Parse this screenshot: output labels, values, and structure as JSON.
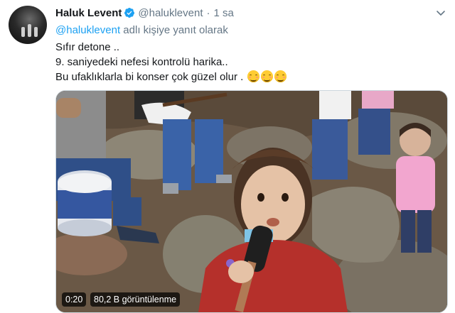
{
  "tweet": {
    "display_name": "Haluk Levent",
    "handle": "@haluklevent",
    "separator": "·",
    "time": "1 sa",
    "reply_mention": "@haluklevent",
    "reply_text": "adlı kişiye yanıt olarak",
    "lines": [
      "Sıfır detone ..",
      "9. saniyedeki nefesi kontrolü harika..",
      "Bu ufaklıklarla bi konser çok güzel olur ."
    ],
    "emoji_icons": [
      "smiling-face-icon",
      "smiling-face-icon",
      "smiling-face-icon"
    ]
  },
  "video": {
    "duration": "0:20",
    "views": "80,2 B görüntülenme"
  },
  "colors": {
    "accent": "#1da1f2",
    "secondary_text": "#657786",
    "primary_text": "#14171a"
  }
}
